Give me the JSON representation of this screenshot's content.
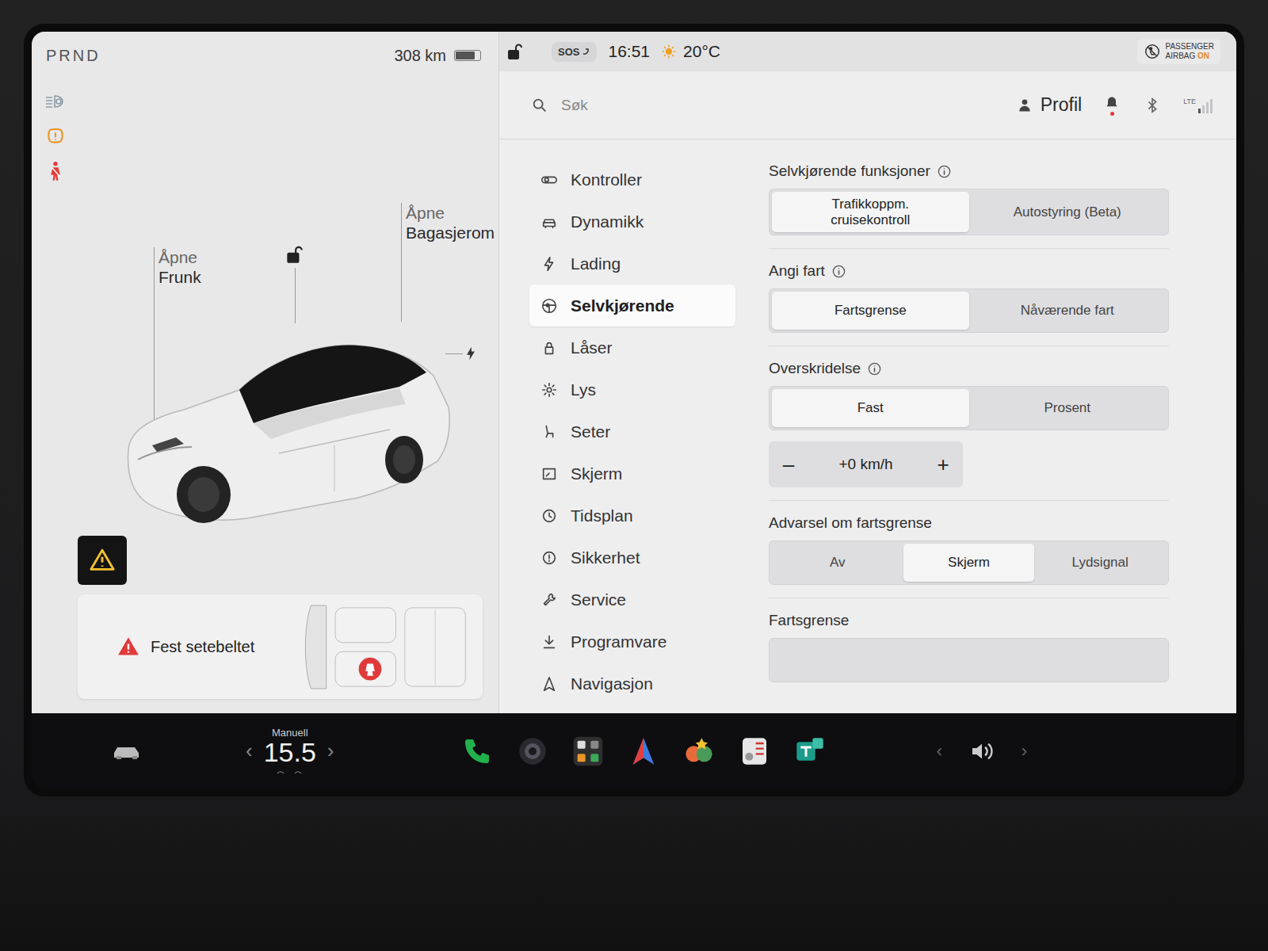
{
  "car_panel": {
    "gear": "PRND",
    "range": "308 km",
    "battery_level": 0.8,
    "locked": false,
    "frunk": {
      "line1": "Åpne",
      "line2": "Frunk"
    },
    "trunk": {
      "line1": "Åpne",
      "line2": "Bagasjerom"
    },
    "alert": {
      "text": "Fest setebeltet",
      "seat_unbuckled": true
    }
  },
  "status_bar": {
    "locked": false,
    "sos": "SOS",
    "time": "16:51",
    "temperature": "20°C",
    "airbag": {
      "line1": "PASSENGER",
      "line2": "AIRBAG",
      "state": "ON"
    }
  },
  "search": {
    "placeholder": "Søk"
  },
  "profile": {
    "label": "Profil",
    "unread_notifications": true,
    "network": "LTE",
    "signal_level": 0.25
  },
  "menu": [
    {
      "label": "Kontroller",
      "selected": false
    },
    {
      "label": "Dynamikk",
      "selected": false
    },
    {
      "label": "Lading",
      "selected": false
    },
    {
      "label": "Selvkjørende",
      "selected": true
    },
    {
      "label": "Låser",
      "selected": false
    },
    {
      "label": "Lys",
      "selected": false
    },
    {
      "label": "Seter",
      "selected": false
    },
    {
      "label": "Skjerm",
      "selected": false
    },
    {
      "label": "Tidsplan",
      "selected": false
    },
    {
      "label": "Sikkerhet",
      "selected": false
    },
    {
      "label": "Service",
      "selected": false
    },
    {
      "label": "Programvare",
      "selected": false
    },
    {
      "label": "Navigasjon",
      "selected": false
    }
  ],
  "settings": [
    {
      "title": "Selvkjørende funksjoner",
      "info": true,
      "options": [
        {
          "label": "Trafikkoppm. cruisekontroll",
          "selected": true
        },
        {
          "label": "Autostyring (Beta)",
          "selected": false
        }
      ],
      "stepper": null
    },
    {
      "title": "Angi fart",
      "info": true,
      "options": [
        {
          "label": "Fartsgrense",
          "selected": true
        },
        {
          "label": "Nåværende fart",
          "selected": false
        }
      ],
      "stepper": null
    },
    {
      "title": "Overskridelse",
      "info": true,
      "options": [
        {
          "label": "Fast",
          "selected": true
        },
        {
          "label": "Prosent",
          "selected": false
        }
      ],
      "stepper": {
        "minus": "–",
        "value": "+0 km/h",
        "plus": "+"
      }
    },
    {
      "title": "Advarsel om fartsgrense",
      "info": false,
      "options": [
        {
          "label": "Av",
          "selected": false
        },
        {
          "label": "Skjerm",
          "selected": true
        },
        {
          "label": "Lydsignal",
          "selected": false
        }
      ],
      "stepper": null
    },
    {
      "title": "Fartsgrense",
      "info": false,
      "options": [],
      "stepper": null
    }
  ],
  "taskbar": {
    "climate": {
      "mode": "Manuell",
      "temperature": "15.5",
      "decrease": "‹",
      "increase": "›"
    },
    "volume": {
      "decrease": "‹",
      "increase": "›"
    }
  }
}
